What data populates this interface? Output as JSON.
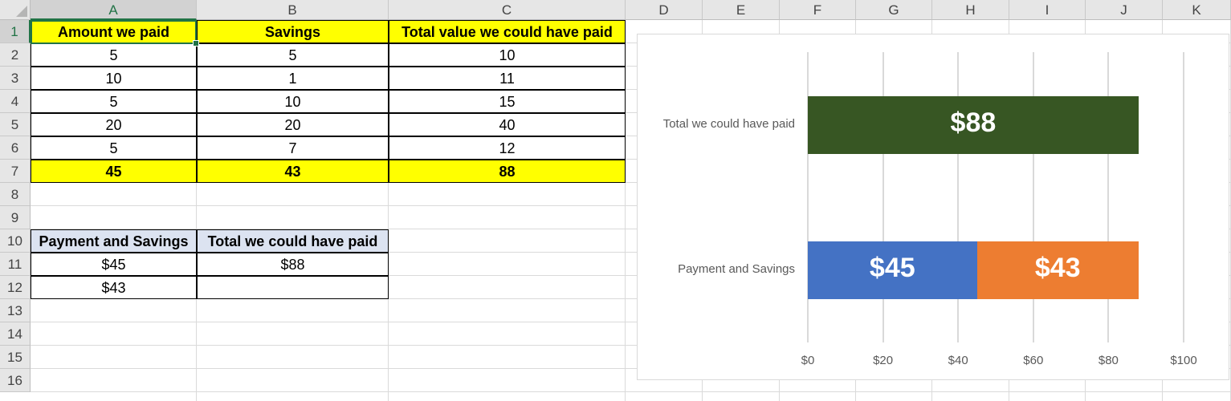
{
  "sheet": {
    "columns": [
      "A",
      "B",
      "C",
      "D",
      "E",
      "F",
      "G",
      "H",
      "I",
      "J",
      "K"
    ],
    "rows": [
      "1",
      "2",
      "3",
      "4",
      "5",
      "6",
      "7",
      "8",
      "9",
      "10",
      "11",
      "12",
      "13",
      "14",
      "15",
      "16"
    ],
    "table1": {
      "headers": [
        "Amount we paid",
        "Savings",
        "Total value we could have paid"
      ],
      "rows": [
        [
          "5",
          "5",
          "10"
        ],
        [
          "10",
          "1",
          "11"
        ],
        [
          "5",
          "10",
          "15"
        ],
        [
          "20",
          "20",
          "40"
        ],
        [
          "5",
          "7",
          "12"
        ]
      ],
      "totals": [
        "45",
        "43",
        "88"
      ]
    },
    "table2": {
      "headers": [
        "Payment and Savings",
        "Total we could have paid"
      ],
      "rows": [
        [
          "$45",
          "$88"
        ],
        [
          "$43",
          ""
        ]
      ]
    }
  },
  "colors": {
    "yellow": "#ffff00",
    "header_blue": "#dce3f1",
    "excel_green": "#217346",
    "bar_dark_green": "#375623",
    "bar_blue": "#4472c4",
    "bar_orange": "#ed7d31"
  },
  "chart_data": {
    "type": "bar",
    "orientation": "horizontal",
    "stacked": true,
    "categories": [
      "Total we could have paid",
      "Payment and Savings"
    ],
    "series": [
      {
        "values": [
          88,
          45
        ],
        "labels": [
          "$88",
          "$45"
        ],
        "colors": [
          "#375623",
          "#4472c4"
        ]
      },
      {
        "values": [
          0,
          43
        ],
        "labels": [
          "",
          "$43"
        ],
        "colors": [
          "#ed7d31",
          "#ed7d31"
        ]
      }
    ],
    "xlim": [
      0,
      100
    ],
    "xticks": [
      0,
      20,
      40,
      60,
      80,
      100
    ],
    "xtick_labels": [
      "$0",
      "$20",
      "$40",
      "$60",
      "$80",
      "$100"
    ],
    "grid": true,
    "legend": "none",
    "title": ""
  }
}
